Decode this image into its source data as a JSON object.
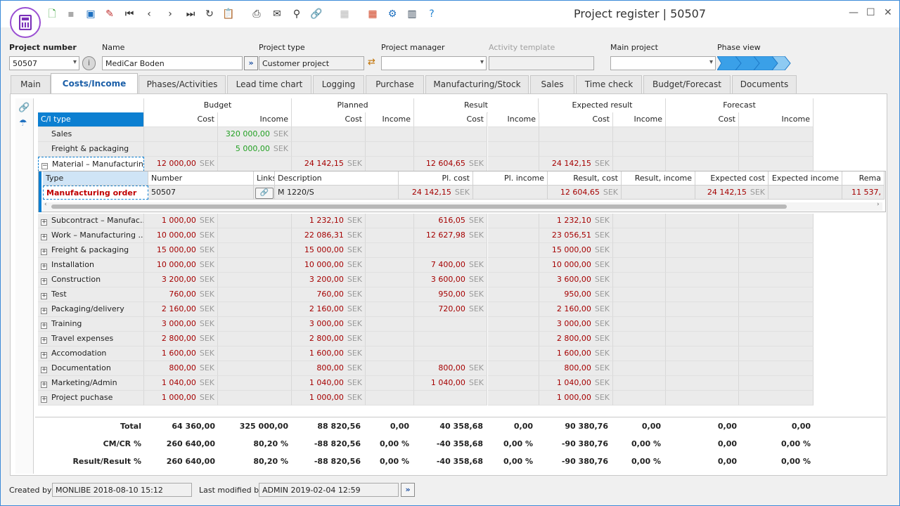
{
  "window": {
    "title": "Project register | 50507"
  },
  "toolbar": {
    "icons": [
      "new-document",
      "save",
      "save-as",
      "delete",
      "first-record",
      "previous-record",
      "next-record",
      "last-record",
      "refresh",
      "clipboard",
      "print",
      "email",
      "search",
      "link",
      "grid",
      "apps",
      "settings",
      "library",
      "help"
    ]
  },
  "form": {
    "project_number_label": "Project number",
    "project_number": "50507",
    "name_label": "Name",
    "name": "MediCar Boden",
    "project_type_label": "Project type",
    "project_type": "Customer project",
    "project_manager_label": "Project manager",
    "project_manager": "",
    "activity_template_label": "Activity template",
    "activity_template": "",
    "main_project_label": "Main project",
    "main_project": "",
    "phase_view_label": "Phase view"
  },
  "tabs": [
    "Main",
    "Costs/Income",
    "Phases/Activities",
    "Lead time chart",
    "Logging",
    "Purchase",
    "Manufacturing/Stock",
    "Sales",
    "Time check",
    "Budget/Forecast",
    "Documents"
  ],
  "active_tab": "Costs/Income",
  "grid": {
    "groups": [
      "Budget",
      "Planned",
      "Result",
      "Expected result",
      "Forecast"
    ],
    "col_ci": "C/I type",
    "col_cost": "Cost",
    "col_income": "Income",
    "currency": "SEK",
    "rows": [
      {
        "type": "Sales",
        "exp": "",
        "bi": "320 000,00"
      },
      {
        "type": "Freight & packaging",
        "exp": "",
        "bi": "5 000,00"
      },
      {
        "type": "Material – Manufacturin...",
        "exp": "−",
        "bc": "12 000,00",
        "pc": "24 142,15",
        "rc": "12 604,65",
        "ec": "24 142,15"
      },
      {
        "type": "Subcontract – Manufac...",
        "exp": "+",
        "bc": "1 000,00",
        "pc": "1 232,10",
        "rc": "616,05",
        "ec": "1 232,10"
      },
      {
        "type": "Work – Manufacturing ...",
        "exp": "+",
        "bc": "10 000,00",
        "pc": "22 086,31",
        "rc": "12 627,98",
        "ec": "23 056,51"
      },
      {
        "type": "Freight & packaging",
        "exp": "+",
        "bc": "15 000,00",
        "pc": "15 000,00",
        "ec": "15 000,00"
      },
      {
        "type": "Installation",
        "exp": "+",
        "bc": "10 000,00",
        "pc": "10 000,00",
        "rc": "7 400,00",
        "ec": "10 000,00"
      },
      {
        "type": "Construction",
        "exp": "+",
        "bc": "3 200,00",
        "pc": "3 200,00",
        "rc": "3 600,00",
        "ec": "3 600,00"
      },
      {
        "type": "Test",
        "exp": "+",
        "bc": "760,00",
        "pc": "760,00",
        "rc": "950,00",
        "ec": "950,00"
      },
      {
        "type": "Packaging/delivery",
        "exp": "+",
        "bc": "2 160,00",
        "pc": "2 160,00",
        "rc": "720,00",
        "ec": "2 160,00"
      },
      {
        "type": "Training",
        "exp": "+",
        "bc": "3 000,00",
        "pc": "3 000,00",
        "ec": "3 000,00"
      },
      {
        "type": "Travel expenses",
        "exp": "+",
        "bc": "2 800,00",
        "pc": "2 800,00",
        "ec": "2 800,00"
      },
      {
        "type": "Accomodation",
        "exp": "+",
        "bc": "1 600,00",
        "pc": "1 600,00",
        "ec": "1 600,00"
      },
      {
        "type": "Documentation",
        "exp": "+",
        "bc": "800,00",
        "pc": "800,00",
        "rc": "800,00",
        "ec": "800,00"
      },
      {
        "type": "Marketing/Admin",
        "exp": "+",
        "bc": "1 040,00",
        "pc": "1 040,00",
        "rc": "1 040,00",
        "ec": "1 040,00"
      },
      {
        "type": "Project puchase",
        "exp": "+",
        "bc": "1 000,00",
        "pc": "1 000,00",
        "ec": "1 000,00"
      }
    ]
  },
  "detail": {
    "headers": [
      "Type",
      "Number",
      "Links",
      "Description",
      "Pl. cost",
      "Pl. income",
      "Result, cost",
      "Result, income",
      "Expected cost",
      "Expected income",
      "Rema"
    ],
    "row": {
      "type": "Manufacturing order",
      "number": "50507",
      "description": "M 1220/S",
      "pl_cost": "24 142,15",
      "result_cost": "12 604,65",
      "expected_cost": "24 142,15",
      "remaining": "11 537,"
    }
  },
  "totals": [
    {
      "label": "Total",
      "values": [
        "64 360,00",
        "325 000,00",
        "88 820,56",
        "0,00",
        "40 358,68",
        "0,00",
        "90 380,76",
        "0,00",
        "0,00",
        "0,00"
      ]
    },
    {
      "label": "CM/CR %",
      "values": [
        "260 640,00",
        "80,20 %",
        "-88 820,56",
        "0,00 %",
        "-40 358,68",
        "0,00 %",
        "-90 380,76",
        "0,00 %",
        "0,00",
        "0,00 %"
      ]
    },
    {
      "label": "Result/Result %",
      "values": [
        "260 640,00",
        "80,20 %",
        "-88 820,56",
        "0,00 %",
        "-40 358,68",
        "0,00 %",
        "-90 380,76",
        "0,00 %",
        "0,00",
        "0,00 %"
      ]
    }
  ],
  "footer": {
    "created_by_label": "Created by",
    "created_by": "MONLIBE 2018-08-10 15:12",
    "modified_by_label": "Last modified by",
    "modified_by": "ADMIN 2019-02-04 12:59"
  },
  "colors": {
    "accent": "#0c7fd1",
    "cost_red": "#a50000",
    "income_green": "#22a022",
    "phase_blue": "#3aa0e8"
  }
}
